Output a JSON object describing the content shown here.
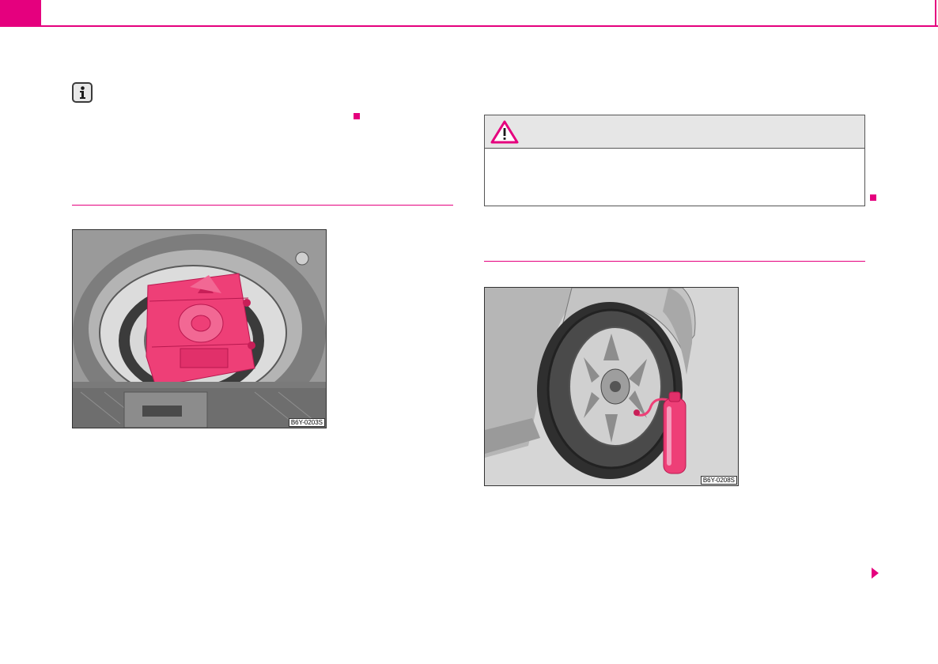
{
  "colors": {
    "accent": "#e5007e",
    "warning_header_bg": "#e6e6e6",
    "figure_highlight": "#ee3f77"
  },
  "icons": {
    "info": "info-icon",
    "warning": "warning-triangle-icon",
    "section_end": "section-end-marker",
    "continue": "continue-arrow-icon"
  },
  "figures": {
    "left": {
      "code": "B6Y-0203S"
    },
    "right": {
      "code": "B6Y-0208S"
    }
  }
}
